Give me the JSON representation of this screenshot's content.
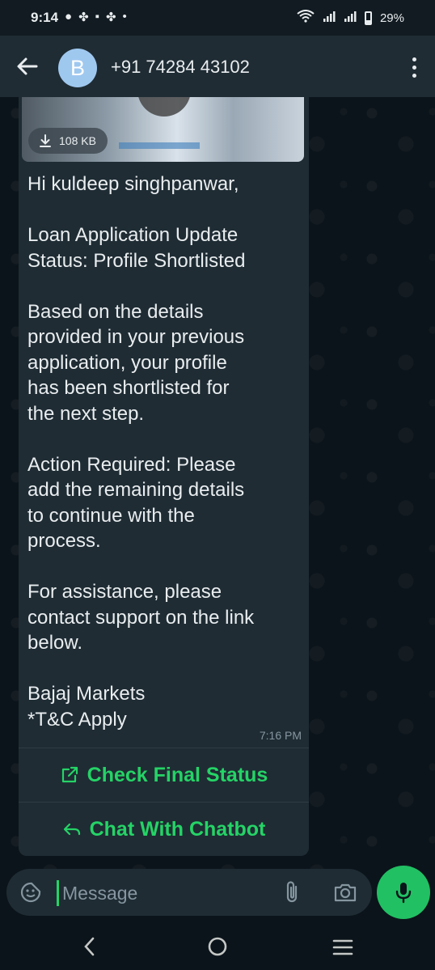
{
  "status_bar": {
    "time": "9:14",
    "battery": "29%"
  },
  "header": {
    "avatar_letter": "B",
    "contact": "+91 74284 43102"
  },
  "message": {
    "download_size": "108 KB",
    "body": "Hi kuldeep singhpanwar,\n\nLoan Application Update\nStatus: Profile Shortlisted\n\nBased on the details\nprovided in your previous\napplication, your profile\nhas been shortlisted for\nthe next step.\n\nAction Required: Please\nadd the remaining details\nto continue with the\nprocess.\n\nFor assistance, please\ncontact support on the link\nbelow.\n\nBajaj Markets\n*T&C Apply",
    "time": "7:16 PM",
    "buttons": [
      {
        "label": "Check Final Status",
        "icon": "external-link-icon"
      },
      {
        "label": "Chat With Chatbot",
        "icon": "reply-icon"
      }
    ]
  },
  "composer": {
    "placeholder": "Message"
  },
  "colors": {
    "accent": "#25d366",
    "bubble": "#1f2c34",
    "background": "#0b141a",
    "appbar": "#1f2c34"
  }
}
